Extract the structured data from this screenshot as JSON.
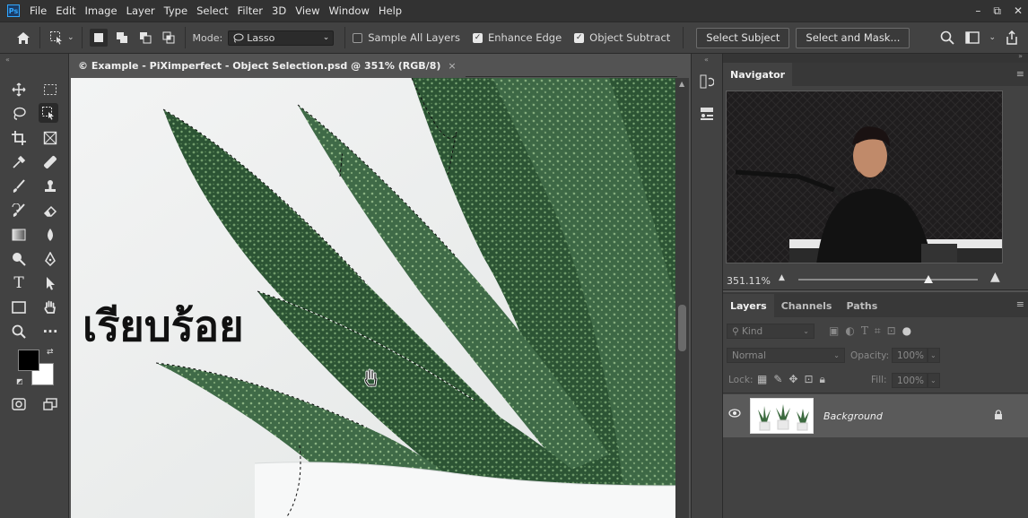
{
  "menubar": {
    "logo": "Ps",
    "items": [
      "File",
      "Edit",
      "Image",
      "Layer",
      "Type",
      "Select",
      "Filter",
      "3D",
      "View",
      "Window",
      "Help"
    ],
    "window_controls": [
      "–",
      "⧉",
      "✕"
    ]
  },
  "options": {
    "mode_label": "Mode:",
    "mode_value": "Lasso",
    "sample_all_layers": "Sample All Layers",
    "enhance_edge": "Enhance Edge",
    "object_subtract": "Object Subtract",
    "select_subject": "Select Subject",
    "select_and_mask": "Select and Mask..."
  },
  "document": {
    "tab_title": "© Example - PiXimperfect - Object Selection.psd @ 351% (RGB/8)",
    "close": "×",
    "overlay_text": "เรียบร้อย"
  },
  "navigator": {
    "title": "Navigator",
    "zoom": "351.11%"
  },
  "layers_panel": {
    "tabs": [
      "Layers",
      "Channels",
      "Paths"
    ],
    "kind_placeholder": "Kind",
    "blend_mode": "Normal",
    "opacity_label": "Opacity:",
    "opacity_value": "100%",
    "lock_label": "Lock:",
    "fill_label": "Fill:",
    "fill_value": "100%",
    "layers": [
      {
        "name": "Background",
        "locked": true,
        "visible": true
      }
    ]
  },
  "colors": {
    "foreground": "#000000",
    "background": "#ffffff",
    "accent": "#31a8ff"
  }
}
